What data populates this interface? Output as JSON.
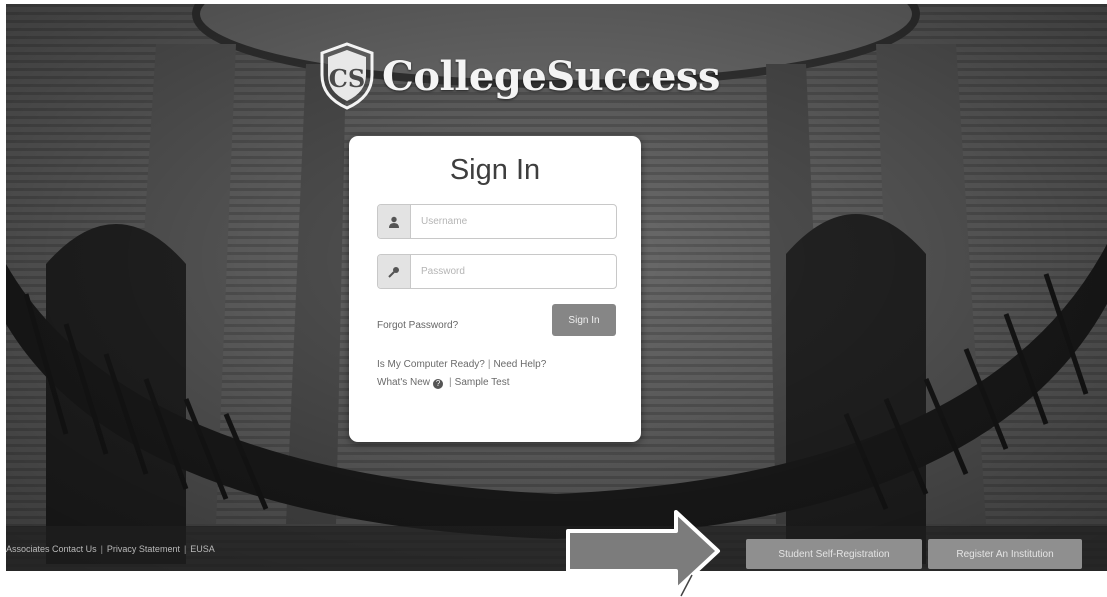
{
  "brand": {
    "name": "CollegeSuccess",
    "logo_text": "CS"
  },
  "login": {
    "title": "Sign In",
    "username_placeholder": "Username",
    "password_placeholder": "Password",
    "forgot_password": "Forgot Password?",
    "sign_in_button": "Sign In",
    "links_row1": [
      "Is My Computer Ready?",
      "Need Help?"
    ],
    "links_row2": [
      "What's New",
      "Sample Test"
    ],
    "separator": "|"
  },
  "footer": {
    "links": [
      "Associates",
      "Contact Us",
      "Privacy Statement",
      "EUSA"
    ],
    "separator": "|",
    "student_registration": "Student Self-Registration",
    "register_institution": "Register An Institution"
  },
  "icons": {
    "username": "user-icon",
    "password": "key-icon",
    "help": "help-circle-icon",
    "logo": "shield-logo-icon",
    "annotation": "arrow-right-icon"
  },
  "colors": {
    "card_bg": "#ffffff",
    "sign_in_button": "#868686",
    "footer_bar": "#1e1e1e",
    "footer_button": "#8f8f8f"
  }
}
